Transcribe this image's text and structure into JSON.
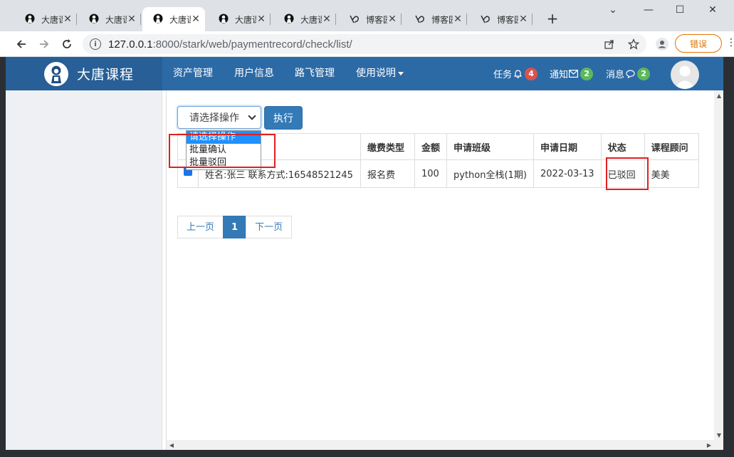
{
  "browser": {
    "tabs": [
      {
        "title": "大唐课",
        "icon": "person-icon"
      },
      {
        "title": "大唐课",
        "icon": "person-icon"
      },
      {
        "title": "大唐课",
        "icon": "person-icon",
        "active": true
      },
      {
        "title": "大唐课",
        "icon": "person-icon"
      },
      {
        "title": "大唐课",
        "icon": "person-icon"
      },
      {
        "title": "博客园",
        "icon": "cnblogs-icon"
      },
      {
        "title": "博客园",
        "icon": "cnblogs-icon"
      },
      {
        "title": "博客园",
        "icon": "cnblogs-icon"
      }
    ],
    "url_host": "127.0.0.1",
    "url_rest": ":8000/stark/web/paymentrecord/check/list/",
    "error_label": "错误"
  },
  "nav": {
    "brand": "大唐课程",
    "menu": [
      "资产管理",
      "用户信息",
      "路飞管理",
      "使用说明"
    ],
    "tasks": {
      "label": "任务",
      "count": "4",
      "color": "#d9534f"
    },
    "notices": {
      "label": "通知",
      "count": "2",
      "color": "#5cb85c"
    },
    "messages": {
      "label": "消息",
      "count": "2",
      "color": "#5cb85c"
    }
  },
  "toolbar": {
    "select_value": "请选择操作",
    "execute_label": "执行",
    "options": [
      "请选择操作",
      "批量确认",
      "批量驳回"
    ]
  },
  "table": {
    "headers": [
      "",
      "",
      "缴费类型",
      "金额",
      "申请班级",
      "申请日期",
      "状态",
      "课程顾问"
    ],
    "rows": [
      {
        "customer": "姓名:张三 联系方式:16548521245",
        "type": "报名费",
        "amount": "100",
        "class": "python全栈(1期)",
        "date": "2022-03-13",
        "status": "已驳回",
        "consultant": "美美"
      }
    ]
  },
  "pagination": {
    "prev": "上一页",
    "current": "1",
    "next": "下一页"
  },
  "colors": {
    "nav": "#2c6aa5",
    "brand_bg": "#275f96",
    "primary": "#337ab7",
    "highlight": "#e02020"
  }
}
